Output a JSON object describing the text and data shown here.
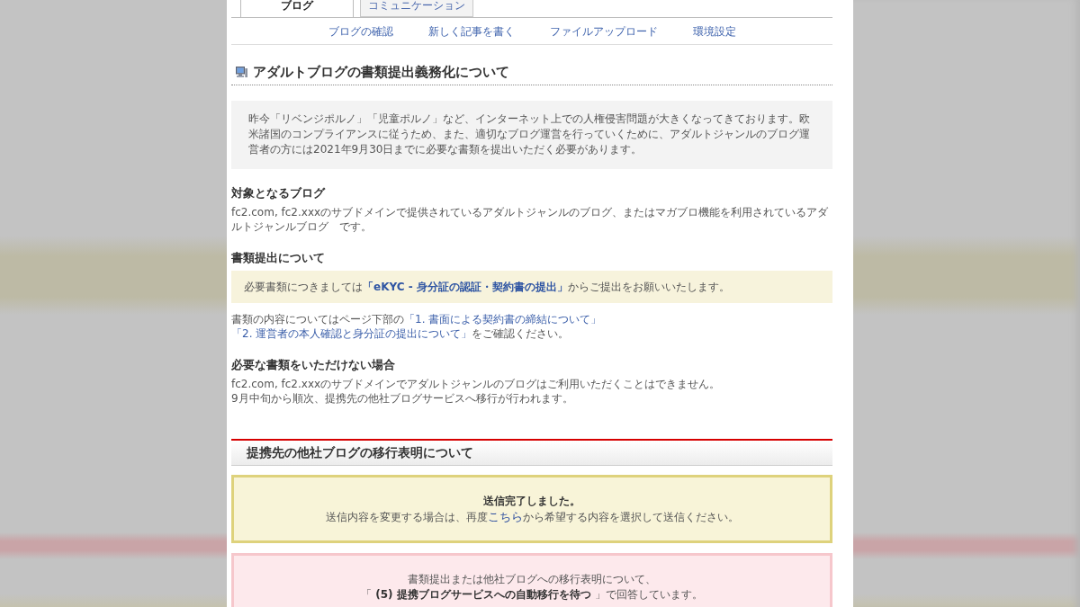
{
  "tabs": [
    {
      "label": "ブログ",
      "selected": true
    },
    {
      "label": "コミュニケーション",
      "selected": false
    }
  ],
  "subnav": [
    {
      "label": "ブログの確認"
    },
    {
      "label": "新しく記事を書く"
    },
    {
      "label": "ファイルアップロード"
    },
    {
      "label": "環境設定"
    }
  ],
  "article": {
    "title": "アダルトブログの書類提出義務化について",
    "intro": "昨今「リベンジポルノ」「児童ポルノ」など、インターネット上での人権侵害問題が大きくなってきております。欧米諸国のコンプライアンスに従うため、また、適切なブログ運営を行っていくために、アダルトジャンルのブログ運営者の方には2021年9月30日までに必要な書類を提出いただく必要があります。",
    "sections": [
      {
        "heading": "対象となるブログ",
        "blocks": [
          {
            "kind": "text",
            "segments": [
              {
                "kind": "text",
                "text": "fc2.com, fc2.xxxのサブドメインで提供されているアダルトジャンルのブログ、またはマガブロ機能を利用されているアダルトジャンルブログ　です。"
              }
            ]
          }
        ]
      },
      {
        "heading": "書類提出について",
        "blocks": [
          {
            "kind": "callout",
            "segments": [
              {
                "kind": "text",
                "text": "必要書類につきましては"
              },
              {
                "kind": "boldlink",
                "text": "「eKYC - 身分証の認証・契約書の提出」"
              },
              {
                "kind": "text",
                "text": "からご提出をお願いいたします。"
              }
            ]
          },
          {
            "kind": "text",
            "segments": [
              {
                "kind": "text",
                "text": "書類の内容についてはページ下部の"
              },
              {
                "kind": "link",
                "text": "「1. 書面による契約書の締結について」"
              },
              {
                "kind": "link",
                "text": "「2. 運営者の本人確認と身分証の提出について」"
              },
              {
                "kind": "text",
                "text": "をご確認ください。"
              }
            ]
          }
        ]
      },
      {
        "heading": "必要な書類をいただけない場合",
        "blocks": [
          {
            "kind": "text",
            "segments": [
              {
                "kind": "text",
                "text": "fc2.com, fc2.xxxのサブドメインでアダルトジャンルのブログはご利用いただくことはできません。\n9月中旬から順次、提携先の他社ブログサービスへ移行が行われます。"
              }
            ]
          }
        ]
      }
    ]
  },
  "migration": {
    "title": "提携先の他社ブログの移行表明について",
    "messages": [
      {
        "kind": "success",
        "title": "送信完了しました。",
        "segments": [
          {
            "kind": "text",
            "text": "送信内容を変更する場合は、再度"
          },
          {
            "kind": "link",
            "text": "こちら"
          },
          {
            "kind": "text",
            "text": "から希望する内容を選択して送信ください。"
          }
        ]
      },
      {
        "kind": "answer",
        "lines": [
          "書類提出または他社ブログへの移行表明について、",
          "「 **(5) 提携ブログサービスへの自動移行を待つ** 」で回答しています。"
        ]
      }
    ]
  }
}
